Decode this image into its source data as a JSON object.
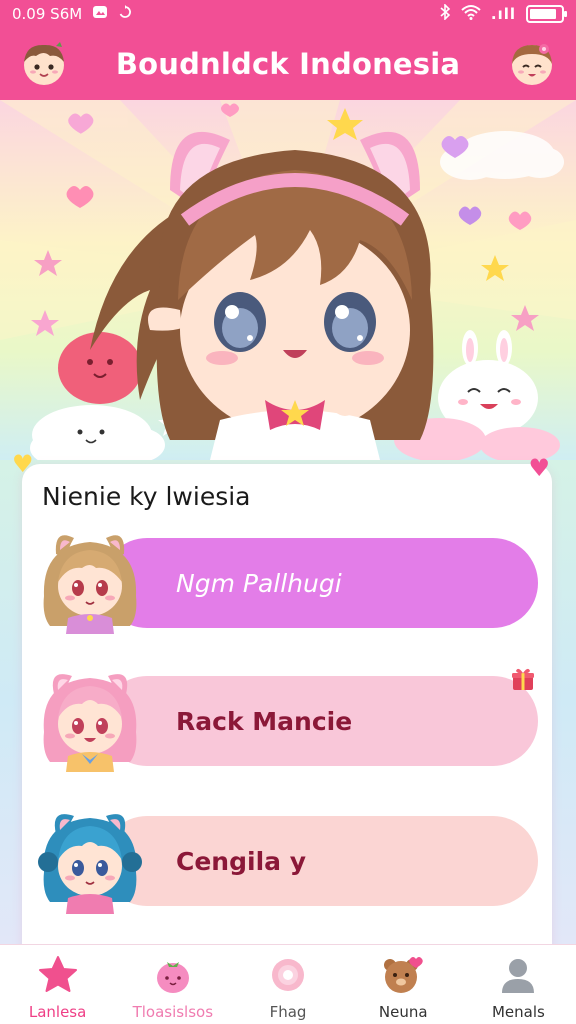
{
  "status_bar": {
    "time": "0.09 S6M",
    "left_icons": [
      "photo-icon",
      "sync-icon"
    ],
    "right_icons": [
      "bluetooth-icon",
      "wifi-icon",
      "signal-icon",
      "battery-icon"
    ],
    "signal_text": ".ıll ",
    "battery_level": 0.85
  },
  "header": {
    "title": "Boudnldck Indonesia",
    "left_avatar": "boy-avatar",
    "right_avatar": "girl-avatar"
  },
  "hero": {
    "image": "chibi-girl-cat-ears-illustration"
  },
  "card": {
    "title": "Nienie ky lwiesia",
    "rows": [
      {
        "label": "Ngm Pallhugi",
        "avatar": "blonde-cat-girl-avatar",
        "color": "#e37de8"
      },
      {
        "label": "Rack Mancie",
        "avatar": "pink-cat-girl-avatar",
        "color": "#f9c7d9"
      },
      {
        "label": "Cengila y",
        "avatar": "blue-cat-girl-avatar",
        "color": "#fbd5d3"
      }
    ]
  },
  "bottom_nav": {
    "items": [
      {
        "label": "Lanlesa",
        "icon": "star-icon",
        "active": true
      },
      {
        "label": "Tloasislsos",
        "icon": "strawberry-icon",
        "active": false
      },
      {
        "label": "Fhag",
        "icon": "donut-icon",
        "active": false
      },
      {
        "label": "Neuna",
        "icon": "bear-icon",
        "active": false
      },
      {
        "label": "Menals",
        "icon": "user-icon",
        "active": false
      }
    ]
  },
  "colors": {
    "brand_pink": "#f24f95",
    "accent_magenta": "#e37de8",
    "label_dark_red": "#8b1838"
  }
}
